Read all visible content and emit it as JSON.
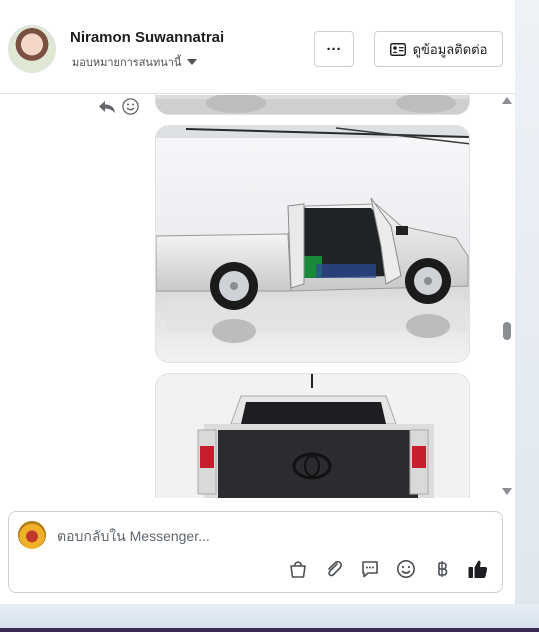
{
  "header": {
    "name": "Niramon Suwannatrai",
    "subtitle": "มอบหมายการสนทนานี้",
    "more_label": "···",
    "contact_label": "ดูข้อมูลติดต่อ"
  },
  "messages": {
    "images": [
      {
        "name": "car-photo-partial"
      },
      {
        "name": "pickup-truck-side-photo"
      },
      {
        "name": "pickup-truck-rear-photo"
      }
    ]
  },
  "composer": {
    "placeholder": "ตอบกลับใน Messenger..."
  },
  "colors": {
    "accent": "#1877f2",
    "text": "#1c1e21",
    "border": "#ccd0d5",
    "icon": "#4b4f56"
  },
  "icons": [
    "reply-icon",
    "emoji-icon",
    "shopping-bag-icon",
    "attachment-icon",
    "saved-reply-icon",
    "emoji-icon",
    "baht-icon",
    "thumbs-up-icon"
  ]
}
